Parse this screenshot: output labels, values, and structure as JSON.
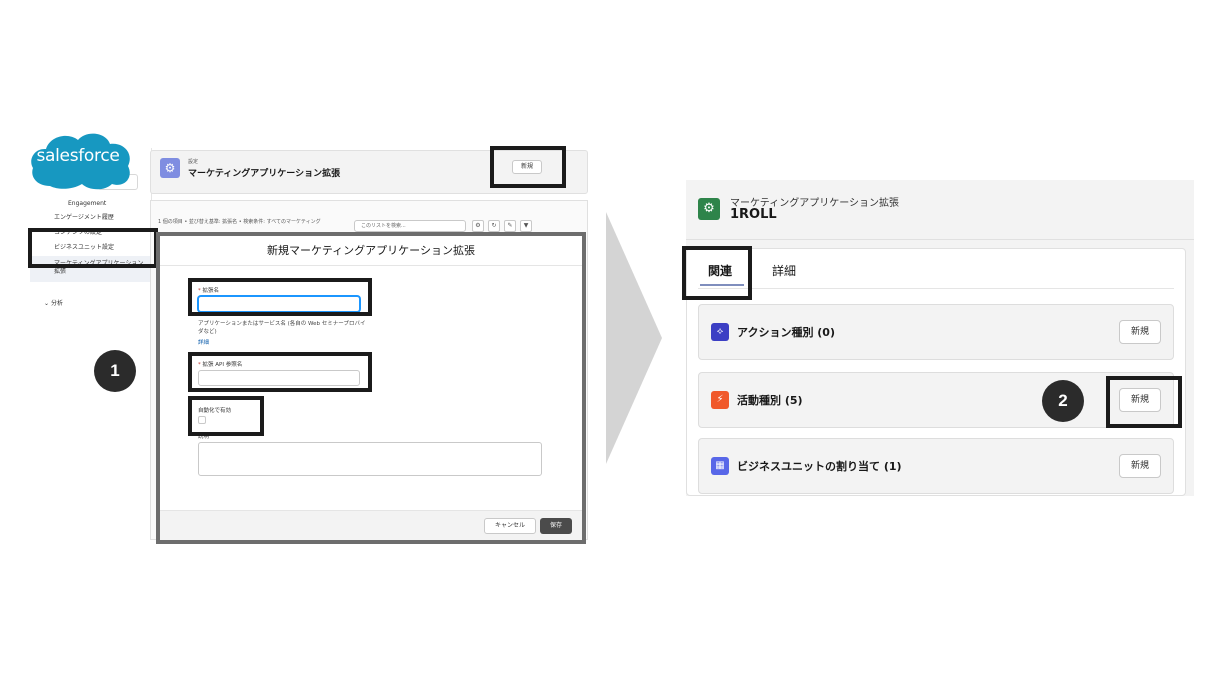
{
  "left_screenshot": {
    "logo_text": "salesforce",
    "sidebar": {
      "items": [
        "Engagement",
        "エンゲージメント履歴",
        "コンテンツの設定",
        "ビジネスユニット設定"
      ],
      "selected_item": "マーケティングアプリケーション拡張",
      "analysis_item": "分析"
    },
    "header": {
      "small_label": "設定",
      "title": "マーケティングアプリケーション拡張",
      "new_button": "新規"
    },
    "list": {
      "meta": "1 個の項目 • 並び替え基準: 拡張名 • 検索条件: すべてのマーケティング",
      "search_placeholder": "このリストを検索..."
    },
    "modal": {
      "title": "新規マーケティングアプリケーション拡張",
      "field_name_label": "拡張名",
      "field_name_help": "アプリケーションまたはサービス名 (各自の Web セミナープロバイダなど)",
      "field_name_help_link": "詳細",
      "field_api_label": "拡張 API 参照名",
      "auto_enable_label": "自動化で有効",
      "description_label": "説明",
      "cancel_button": "キャンセル",
      "save_button": "保存"
    },
    "step_number": "1"
  },
  "right_screenshot": {
    "header": {
      "small_label": "マーケティングアプリケーション拡張",
      "title": "1ROLL"
    },
    "tabs": [
      {
        "label": "関連",
        "active": true
      },
      {
        "label": "詳細",
        "active": false
      }
    ],
    "related_lists": [
      {
        "label": "アクション種別 (0)",
        "button": "新規",
        "icon": "action-type-icon",
        "color": "#3c3fc4"
      },
      {
        "label": "活動種別 (5)",
        "button": "新規",
        "icon": "activity-type-icon",
        "color": "#f0592b"
      },
      {
        "label": "ビジネスユニットの割り当て (1)",
        "button": "新規",
        "icon": "business-unit-icon",
        "color": "#5867e8"
      }
    ],
    "step_number": "2"
  },
  "colors": {
    "highlight_border": "#1b1b1b",
    "salesforce_blue": "#1798c1",
    "arrow_gray": "#d4d4d4"
  }
}
